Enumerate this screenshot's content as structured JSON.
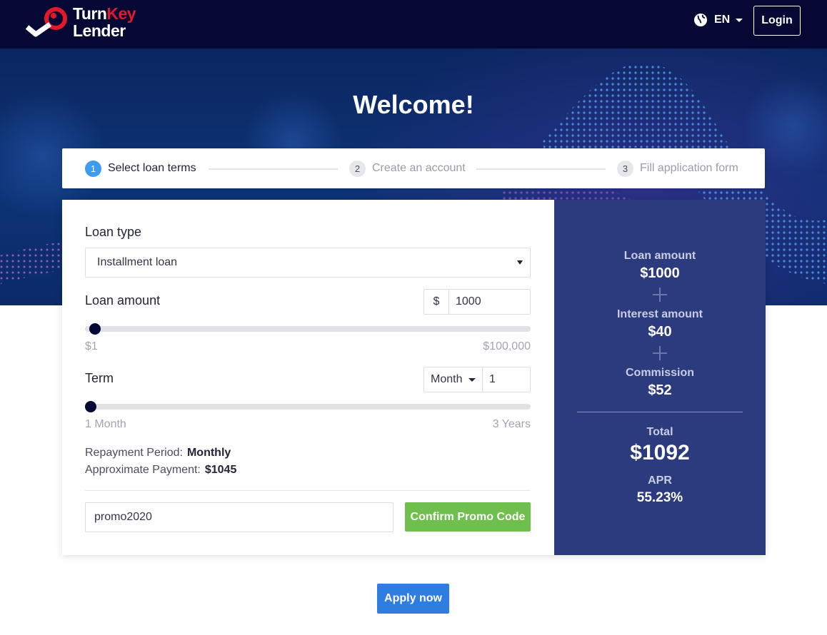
{
  "header": {
    "logo_word1": "Turn",
    "logo_word2": "Key",
    "logo_word3": "Lender",
    "language": "EN",
    "login_label": "Login",
    "icons": [
      "logo-key-icon",
      "globe-icon",
      "chevron-down-icon"
    ],
    "colors": {
      "background": "#050833",
      "brand_red": "#e3182d"
    }
  },
  "hero": {
    "title": "Welcome!"
  },
  "steps": [
    {
      "number": "1",
      "label": "Select loan terms",
      "state": "active"
    },
    {
      "number": "2",
      "label": "Create an account",
      "state": "inactive"
    },
    {
      "number": "3",
      "label": "Fill application form",
      "state": "inactive"
    }
  ],
  "form": {
    "loan_type_label": "Loan type",
    "loan_type_value": "Installment loan",
    "loan_amount_label": "Loan amount",
    "currency_symbol": "$",
    "loan_amount_value": "1000",
    "amount_min": "$1",
    "amount_max": "$100,000",
    "amount_slider_fraction": 0.01,
    "term_label": "Term",
    "term_unit": "Month",
    "term_value": "1",
    "term_min": "1 Month",
    "term_max": "3 Years",
    "term_slider_fraction": 0.0,
    "repayment_period_label": "Repayment Period:",
    "repayment_period_value": "Monthly",
    "approx_payment_label": "Approximate Payment:",
    "approx_payment_value": "$1045",
    "promo_code_value": "promo2020",
    "promo_button_label": "Confirm Promo Code"
  },
  "summary": {
    "loan_amount_label": "Loan amount",
    "loan_amount_value": "$1000",
    "interest_label": "Interest amount",
    "interest_value": "$40",
    "commission_label": "Commission",
    "commission_value": "$52",
    "total_label": "Total",
    "total_value": "$1092",
    "apr_label": "APR",
    "apr_value": "55.23%",
    "colors": {
      "panel": "#2c3a7e"
    }
  },
  "apply_label": "Apply now",
  "colors": {
    "primary_blue": "#2e7de1",
    "promo_green": "#6ebf4e",
    "step_active": "#3c9cf0"
  }
}
